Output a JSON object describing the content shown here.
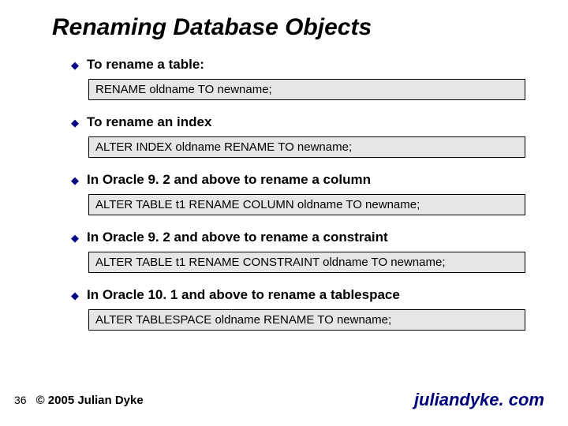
{
  "title": "Renaming Database Objects",
  "items": [
    {
      "desc": "To rename a table:",
      "code": "RENAME oldname TO newname;"
    },
    {
      "desc": "To rename an index",
      "code": "ALTER INDEX oldname RENAME TO newname;"
    },
    {
      "desc": "In Oracle 9. 2 and above to rename a column",
      "code": "ALTER TABLE t1 RENAME COLUMN oldname TO newname;"
    },
    {
      "desc": "In Oracle 9. 2 and above to rename a constraint",
      "code": "ALTER TABLE t1 RENAME CONSTRAINT oldname TO newname;"
    },
    {
      "desc": "In Oracle 10. 1 and above to rename a tablespace",
      "code": "ALTER TABLESPACE  oldname RENAME TO newname;"
    }
  ],
  "footer": {
    "page": "36",
    "copyright": "© 2005 Julian Dyke",
    "site": "juliandyke. com"
  }
}
